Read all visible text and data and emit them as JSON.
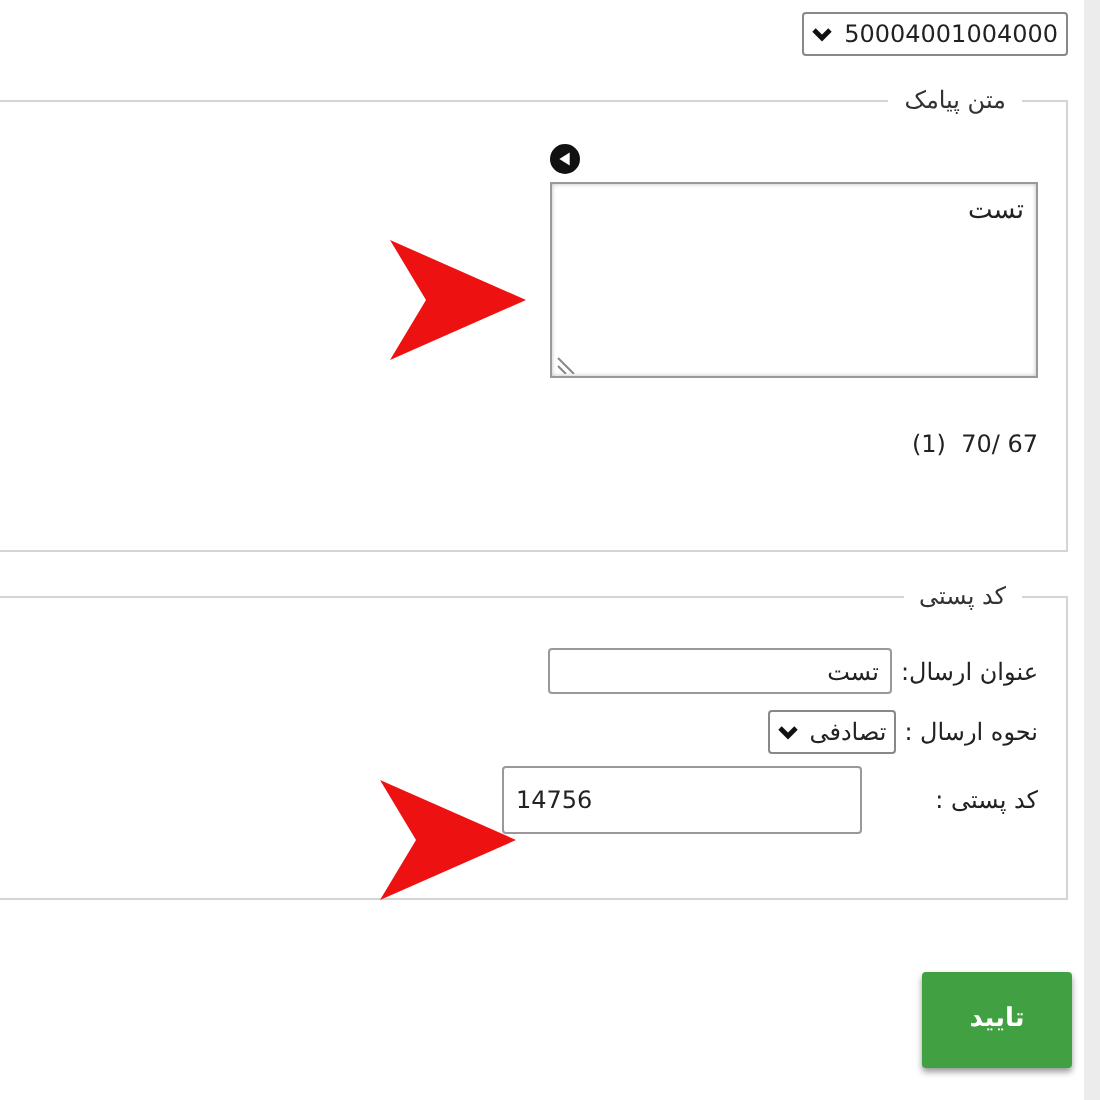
{
  "sender_select": {
    "value": "50004001004000"
  },
  "message_section": {
    "legend": "متن پیامک",
    "text": "تست",
    "counter": "(1)  70/ 67"
  },
  "postal_section": {
    "legend": "کد پستی",
    "fields": [
      {
        "kind": "text",
        "label": "عنوان ارسال:",
        "value": "تست"
      },
      {
        "kind": "select",
        "label": "نحوه ارسال :",
        "value": "تصادفی"
      },
      {
        "kind": "big",
        "label": "کد پستی :",
        "value": "14756"
      }
    ]
  },
  "submit_button": "تایید"
}
